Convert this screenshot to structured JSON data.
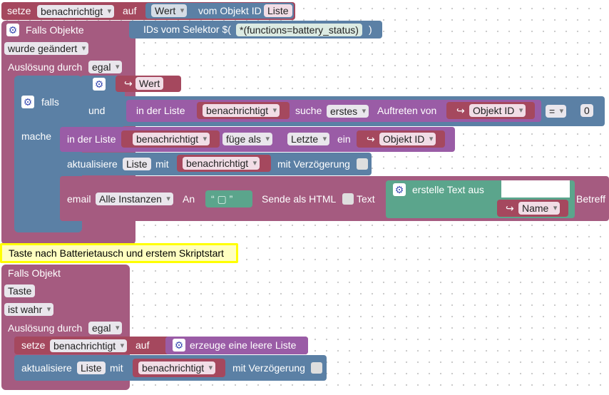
{
  "top_set": {
    "setze": "setze",
    "var": "benachrichtigt",
    "auf": "auf",
    "wert": "Wert",
    "vom_objekt": "vom Objekt ID",
    "liste": "Liste"
  },
  "trigger1": {
    "falls_objekte": "Falls Objekte",
    "selector_label": "IDs vom Selektor $(",
    "selector_value": "*(functions=battery_status)",
    "selector_close": ")",
    "wurde": "wurde geändert",
    "ausloesung": "Auslösung durch",
    "egal": "egal"
  },
  "if_block": {
    "falls": "falls",
    "und": "und",
    "mache": "mache",
    "wert_arrow": "Wert",
    "in_der_liste": "in der Liste",
    "list_var": "benachrichtigt",
    "suche": "suche",
    "erstes": "erstes",
    "auftreten": "Auftreten von",
    "objekt_id": "Objekt ID",
    "eq": "=",
    "zero": "0"
  },
  "insert": {
    "in_der_liste": "in der Liste",
    "var": "benachrichtigt",
    "fuege_als": "füge als",
    "letzte": "Letzte",
    "ein": "ein",
    "objekt_id": "Objekt ID"
  },
  "update1": {
    "aktualisiere": "aktualisiere",
    "liste": "Liste",
    "mit": "mit",
    "var": "benachrichtigt",
    "verzoegerung": "mit Verzögerung"
  },
  "email": {
    "email": "email",
    "instanzen": "Alle Instanzen",
    "an": "An",
    "sende_html": "Sende als HTML",
    "text": "Text",
    "erstelle": "erstelle Text aus",
    "name": "Name",
    "betreff": "Betreff"
  },
  "comment": "Taste nach Batterietausch und erstem Skriptstart",
  "trigger2": {
    "falls_objekt": "Falls Objekt",
    "taste": "Taste",
    "ist_wahr": "ist wahr",
    "ausloesung": "Auslösung durch",
    "egal": "egal"
  },
  "set2": {
    "setze": "setze",
    "var": "benachrichtigt",
    "auf": "auf",
    "erzeuge": "erzeuge eine leere Liste"
  },
  "update2": {
    "aktualisiere": "aktualisiere",
    "liste": "Liste",
    "mit": "mit",
    "var": "benachrichtigt",
    "verzoegerung": "mit Verzögerung"
  },
  "icons": [
    "gear-icon",
    "arrow-hook-icon",
    "quote-icon",
    "chevron-down-icon"
  ],
  "colors": {
    "trigger": "#a55b80",
    "variable": "#a5485e",
    "list": "#9a5ca6",
    "logic": "#5b80a5",
    "text": "#5ba58c",
    "comment_bg": "#ffffc0",
    "comment_border": "#ffff00"
  }
}
